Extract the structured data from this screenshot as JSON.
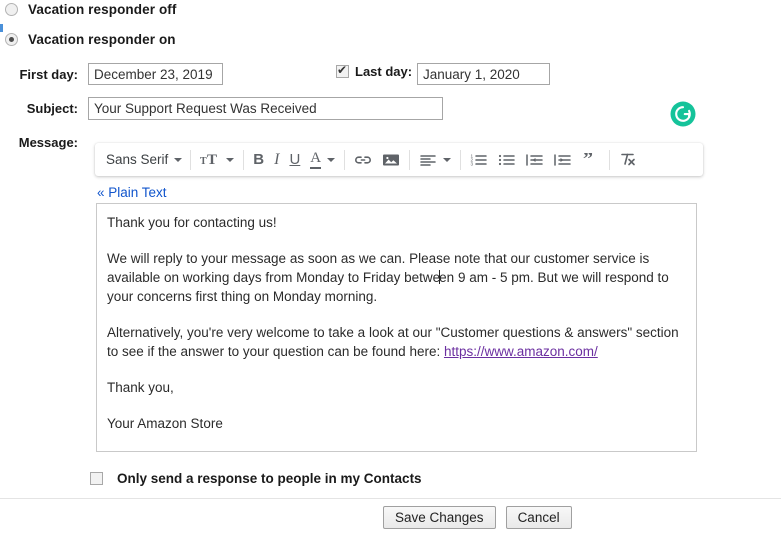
{
  "vacation": {
    "option_off": "Vacation responder off",
    "option_on": "Vacation responder on",
    "selected": "on"
  },
  "fields": {
    "first_day_label": "First day:",
    "first_day_value": "December 23, 2019",
    "last_day_label": "Last day:",
    "last_day_value": "January 1, 2020",
    "last_day_checked": true,
    "subject_label": "Subject:",
    "subject_value": "Your Support Request Was Received",
    "message_label": "Message:"
  },
  "toolbar": {
    "font_family": "Sans Serif",
    "items": [
      {
        "name": "font-family-dropdown",
        "label": "Sans Serif"
      },
      {
        "name": "font-size-button",
        "label": "Size"
      },
      {
        "name": "bold-button",
        "label": "B"
      },
      {
        "name": "italic-button",
        "label": "I"
      },
      {
        "name": "underline-button",
        "label": "U"
      },
      {
        "name": "text-color-button",
        "label": "A"
      },
      {
        "name": "insert-link-button",
        "label": "Link"
      },
      {
        "name": "insert-image-button",
        "label": "Image"
      },
      {
        "name": "align-button",
        "label": "Align"
      },
      {
        "name": "numbered-list-button",
        "label": "Numbered list"
      },
      {
        "name": "bulleted-list-button",
        "label": "Bulleted list"
      },
      {
        "name": "outdent-button",
        "label": "Outdent"
      },
      {
        "name": "indent-button",
        "label": "Indent"
      },
      {
        "name": "quote-button",
        "label": "Quote"
      },
      {
        "name": "remove-formatting-button",
        "label": "Remove formatting"
      }
    ]
  },
  "editor": {
    "plain_text_link": "« Plain Text",
    "paragraphs": {
      "p1": "Thank you for contacting us!",
      "p2a": "We will reply to your message as soon as we can. Please note that our customer service is available on working days from Monday to Friday betwe",
      "p2b": "en 9 am - 5 pm. But we will respond to your concerns first thing on Monday morning.",
      "p3a": "Alternatively, you're very welcome to take a look at our \"Customer questions & answers\" section to see if the answer to your question can be found here: ",
      "p3_link": "https://www.amazon.com/",
      "p4": "Thank you,",
      "p5": "Your Amazon Store"
    }
  },
  "contacts": {
    "label": "Only send a response to people in my Contacts",
    "checked": false
  },
  "footer": {
    "save_label": "Save Changes",
    "cancel_label": "Cancel"
  },
  "badges": {
    "grammarly": "grammarly-icon"
  },
  "colors": {
    "link": "#1155cc",
    "visited_link": "#6b2fa0",
    "grammarly_green": "#15c39a",
    "focus_blue": "#4a90d9"
  }
}
